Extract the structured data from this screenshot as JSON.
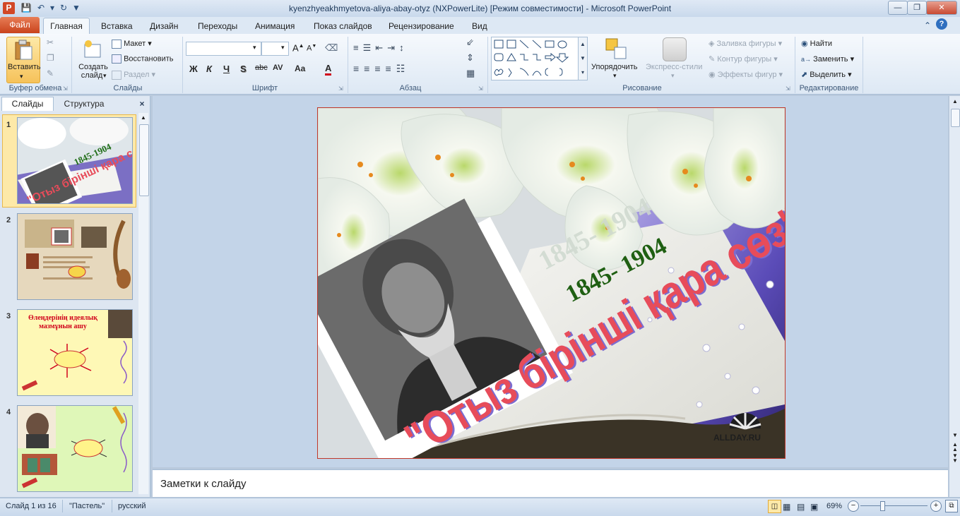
{
  "window": {
    "title": "kyenzhyeakhmyetova-aliya-abay-otyz (NXPowerLite) [Режим совместимости]  -  Microsoft PowerPoint",
    "logo_letter": "P"
  },
  "tabs": {
    "file": "Файл",
    "items": [
      "Главная",
      "Вставка",
      "Дизайн",
      "Переходы",
      "Анимация",
      "Показ слайдов",
      "Рецензирование",
      "Вид"
    ]
  },
  "ribbon": {
    "clipboard": {
      "paste": "Вставить",
      "label": "Буфер обмена"
    },
    "slides": {
      "new_slide_1": "Создать",
      "new_slide_2": "слайд",
      "layout": "Макет",
      "reset": "Восстановить",
      "section": "Раздел",
      "label": "Слайды"
    },
    "font": {
      "label": "Шрифт",
      "bold": "Ж",
      "italic": "К",
      "underline": "Ч",
      "shadow": "S",
      "strike": "abc",
      "spacing": "AV",
      "case": "Aa",
      "color": "A"
    },
    "paragraph": {
      "label": "Абзац"
    },
    "drawing": {
      "arrange": "Упорядочить",
      "quick_styles": "Экспресс-стили",
      "fill": "Заливка фигуры",
      "outline": "Контур фигуры",
      "effects": "Эффекты фигур",
      "label": "Рисование"
    },
    "editing": {
      "find": "Найти",
      "replace": "Заменить",
      "select": "Выделить",
      "label": "Редактирование"
    }
  },
  "left_pane": {
    "tab_slides": "Слайды",
    "tab_outline": "Структура",
    "close": "×",
    "thumbs": [
      {
        "num": "1",
        "years": "1845-1904",
        "title": "\"Отыз бірінші қара сөз\""
      },
      {
        "num": "2"
      },
      {
        "num": "3",
        "heading": "Өлеңдерінің идеялық мазмұнын ашу"
      },
      {
        "num": "4"
      }
    ]
  },
  "slide": {
    "years_shadow": "1845- 1904",
    "years": "1845- 1904",
    "title": "\"Отыз бірінші қара сөз\"",
    "watermark": "ALLDAY.RU"
  },
  "notes": {
    "placeholder": "Заметки к слайду"
  },
  "status": {
    "slide_of": "Слайд 1 из 16",
    "theme": "\"Пастель\"",
    "language": "русский",
    "zoom": "69%",
    "zoom_level": 0.69
  },
  "colors": {
    "accent": "#c9431c",
    "ribbon": "#dde8f4",
    "title_red": "#e74c5a",
    "years_green": "#1f5f12"
  }
}
